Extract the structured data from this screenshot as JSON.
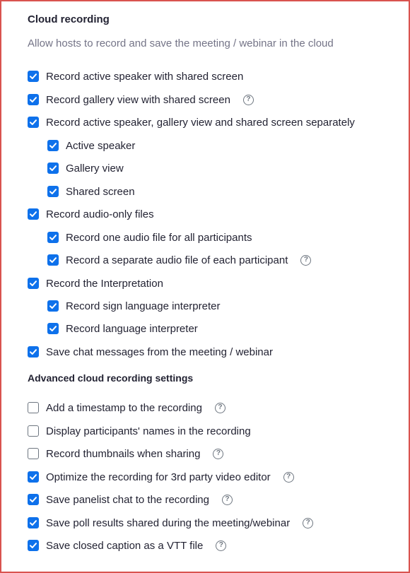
{
  "cloud": {
    "title": "Cloud recording",
    "description": "Allow hosts to record and save the meeting / webinar in the cloud",
    "items": [
      {
        "label": "Record active speaker with shared screen",
        "checked": true
      },
      {
        "label": "Record gallery view with shared screen",
        "checked": true,
        "help": true
      },
      {
        "label": "Record active speaker, gallery view and shared screen separately",
        "checked": true
      },
      {
        "label": "Active speaker",
        "checked": true
      },
      {
        "label": "Gallery view",
        "checked": true
      },
      {
        "label": "Shared screen",
        "checked": true
      },
      {
        "label": "Record audio-only files",
        "checked": true
      },
      {
        "label": "Record one audio file for all participants",
        "checked": true
      },
      {
        "label": "Record a separate audio file of each participant",
        "checked": true,
        "help": true
      },
      {
        "label": "Record the Interpretation",
        "checked": true
      },
      {
        "label": "Record sign language interpreter",
        "checked": true
      },
      {
        "label": "Record language interpreter",
        "checked": true
      },
      {
        "label": "Save chat messages from the meeting / webinar",
        "checked": true
      }
    ]
  },
  "advanced": {
    "title": "Advanced cloud recording settings",
    "items": [
      {
        "label": "Add a timestamp to the recording",
        "checked": false,
        "help": true
      },
      {
        "label": "Display participants' names in the recording",
        "checked": false
      },
      {
        "label": "Record thumbnails when sharing",
        "checked": false,
        "help": true
      },
      {
        "label": "Optimize the recording for 3rd party video editor",
        "checked": true,
        "help": true
      },
      {
        "label": "Save panelist chat to the recording",
        "checked": true,
        "help": true
      },
      {
        "label": "Save poll results shared during the meeting/webinar",
        "checked": true,
        "help": true
      },
      {
        "label": "Save closed caption as a VTT file",
        "checked": true,
        "help": true
      }
    ]
  },
  "help_glyph": "?",
  "colors": {
    "accent": "#0e71eb",
    "border": "#d9534f",
    "muted_text": "#747487"
  }
}
